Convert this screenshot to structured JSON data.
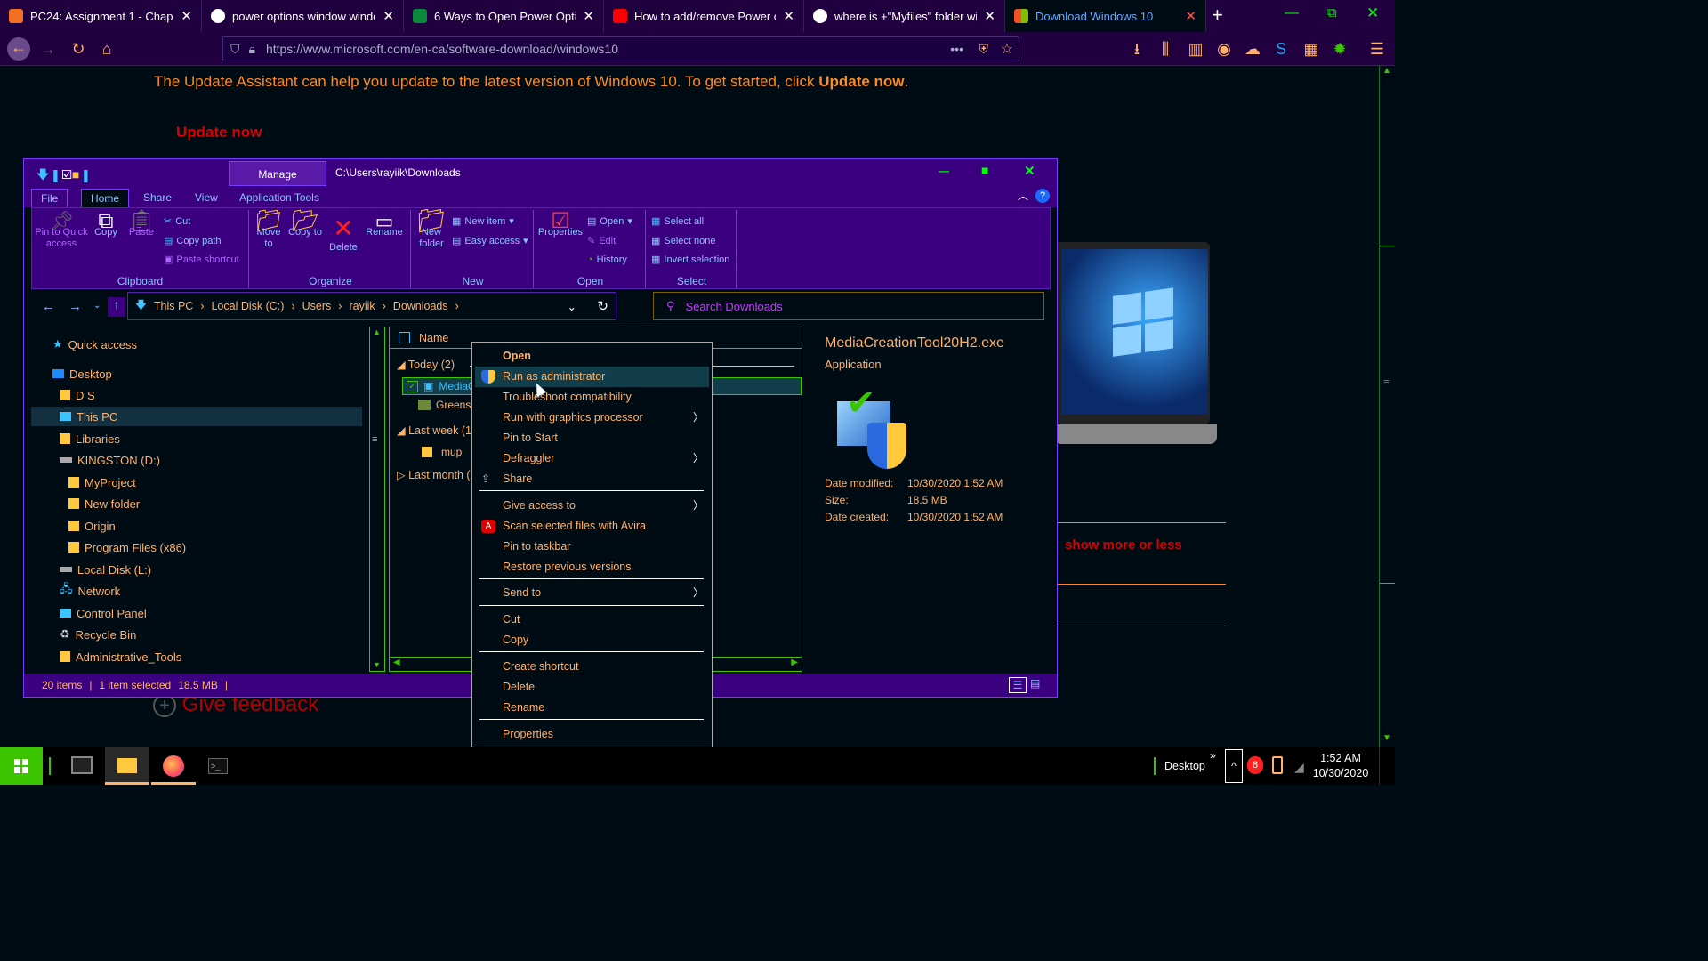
{
  "browser": {
    "tabs": [
      {
        "title": "PC24: Assignment 1 - Chapter",
        "icon": "moodle-icon",
        "color": "#f36f21"
      },
      {
        "title": "power options window windo",
        "icon": "google-icon",
        "color": "#ffffff"
      },
      {
        "title": "6 Ways to Open Power Option",
        "icon": "website-icon",
        "color": "#0a8a3a"
      },
      {
        "title": "How to add/remove Power op",
        "icon": "youtube-icon",
        "color": "#ff0000"
      },
      {
        "title": "where is +\"Myfiles\" folder win",
        "icon": "google-icon",
        "color": "#ffffff"
      },
      {
        "title": "Download Windows 10",
        "icon": "microsoft-icon",
        "color": "#f35325"
      }
    ],
    "url": "https://www.microsoft.com/en-ca/software-download/windows10"
  },
  "page": {
    "update_text": "The Update Assistant can help you update to the latest version of Windows 10. To get started, click",
    "update_bold": "Update now",
    "update_period": ".",
    "update_button": "Update now",
    "show_more": "show more or less",
    "feedback": "Give feedback"
  },
  "explorer": {
    "manage_label": "Manage",
    "path_title": "C:\\Users\\rayiik\\Downloads",
    "ribbon_tabs": [
      "File",
      "Home",
      "Share",
      "View",
      "Application Tools"
    ],
    "clipboard": {
      "pin": "Pin to Quick access",
      "copy": "Copy",
      "paste": "Paste",
      "cut": "Cut",
      "copy_path": "Copy path",
      "paste_shortcut": "Paste shortcut",
      "label": "Clipboard"
    },
    "organize": {
      "move": "Move to",
      "copy": "Copy to",
      "delete": "Delete",
      "rename": "Rename",
      "label": "Organize"
    },
    "new": {
      "new_folder": "New folder",
      "new_item": "New item",
      "easy_access": "Easy access",
      "label": "New"
    },
    "open": {
      "properties": "Properties",
      "open": "Open",
      "edit": "Edit",
      "history": "History",
      "label": "Open"
    },
    "select": {
      "all": "Select all",
      "none": "Select none",
      "invert": "Invert selection",
      "label": "Select"
    },
    "breadcrumb": [
      "This PC",
      "Local Disk (C:)",
      "Users",
      "rayiik",
      "Downloads"
    ],
    "search_placeholder": "Search Downloads",
    "nav": [
      {
        "label": "Quick access",
        "icon": "star-icon"
      },
      {
        "label": "Desktop",
        "icon": "desktop-icon"
      },
      {
        "label": "D S",
        "icon": "user-folder-icon"
      },
      {
        "label": "This PC",
        "icon": "computer-icon"
      },
      {
        "label": "Libraries",
        "icon": "folder-icon"
      },
      {
        "label": "KINGSTON (D:)",
        "icon": "drive-icon"
      },
      {
        "label": "MyProject",
        "icon": "folder-icon"
      },
      {
        "label": "New folder",
        "icon": "folder-icon"
      },
      {
        "label": "Origin",
        "icon": "folder-icon"
      },
      {
        "label": "Program Files (x86)",
        "icon": "folder-icon"
      },
      {
        "label": "Local Disk (L:)",
        "icon": "drive-icon"
      },
      {
        "label": "Network",
        "icon": "network-icon"
      },
      {
        "label": "Control Panel",
        "icon": "control-panel-icon"
      },
      {
        "label": "Recycle Bin",
        "icon": "recycle-bin-icon"
      },
      {
        "label": "Administrative_Tools",
        "icon": "folder-icon"
      }
    ],
    "list_header": "Name",
    "groups": {
      "today": "Today (2)",
      "last_week": "Last week (1)",
      "last_month": "Last month (1"
    },
    "files": {
      "f1": "MediaC",
      "f2": "Greens",
      "f3": "mup"
    },
    "details": {
      "name": "MediaCreationTool20H2.exe",
      "type": "Application",
      "modified_label": "Date modified:",
      "modified": "10/30/2020 1:52 AM",
      "size_label": "Size:",
      "size": "18.5 MB",
      "created_label": "Date created:",
      "created": "10/30/2020 1:52 AM"
    },
    "status": {
      "items": "20 items",
      "selected": "1 item selected",
      "size": "18.5 MB"
    }
  },
  "context_menu": [
    "Open",
    "Run as administrator",
    "Troubleshoot compatibility",
    "Run with graphics processor",
    "Pin to Start",
    "Defraggler",
    "Share",
    "Give access to",
    "Scan selected files with Avira",
    "Pin to taskbar",
    "Restore previous versions",
    "Send to",
    "Cut",
    "Copy",
    "Create shortcut",
    "Delete",
    "Rename",
    "Properties"
  ],
  "taskbar": {
    "desktop": "Desktop",
    "time": "1:52 AM",
    "date": "10/30/2020",
    "chevron": "»"
  }
}
